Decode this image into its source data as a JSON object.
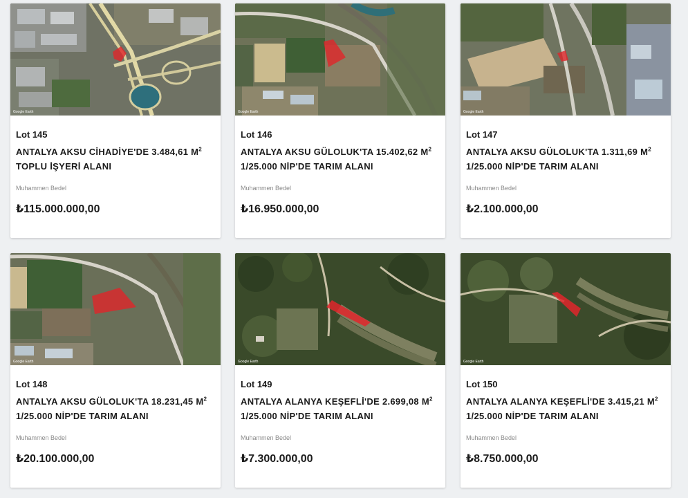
{
  "price_label": "Muhammen Bedel",
  "lots": [
    {
      "lot": "Lot 145",
      "title": "ANTALYA AKSU CİHADİYE'DE 3.484,61 M",
      "title_sup": "2",
      "subtitle": "TOPLU İŞYERİ ALANI",
      "price": "₺115.000.000,00",
      "image": "aerial-map-industrial-interchange"
    },
    {
      "lot": "Lot 146",
      "title": "ANTALYA AKSU GÜLOLUK'TA 15.402,62 M",
      "title_sup": "2",
      "subtitle": "1/25.000 NİP'DE TARIM ALANI",
      "price": "₺16.950.000,00",
      "image": "aerial-map-farmland-river"
    },
    {
      "lot": "Lot 147",
      "title": "ANTALYA AKSU GÜLOLUK'TA 1.311,69 M",
      "title_sup": "2",
      "subtitle": "1/25.000 NİP'DE TARIM ALANI",
      "price": "₺2.100.000,00",
      "image": "aerial-map-farmland-greenhouses"
    },
    {
      "lot": "Lot 148",
      "title": "ANTALYA AKSU GÜLOLUK'TA 18.231,45 M",
      "title_sup": "2",
      "subtitle": "1/25.000 NİP'DE TARIM ALANI",
      "price": "₺20.100.000,00",
      "image": "aerial-map-farmland-river"
    },
    {
      "lot": "Lot 149",
      "title": "ANTALYA ALANYA KEŞEFLİ'DE 2.699,08 M",
      "title_sup": "2",
      "subtitle": "1/25.000 NİP'DE TARIM ALANI",
      "price": "₺7.300.000,00",
      "image": "aerial-map-forest-terraces"
    },
    {
      "lot": "Lot 150",
      "title": "ANTALYA ALANYA KEŞEFLİ'DE 3.415,21 M",
      "title_sup": "2",
      "subtitle": "1/25.000 NİP'DE TARIM ALANI",
      "price": "₺8.750.000,00",
      "image": "aerial-map-forest-terraces"
    }
  ],
  "colors": {
    "parcel_highlight": "#e0262b",
    "background": "#eef0f2",
    "card": "#ffffff",
    "text": "#1b1b1b",
    "muted": "#8a8a8a"
  }
}
